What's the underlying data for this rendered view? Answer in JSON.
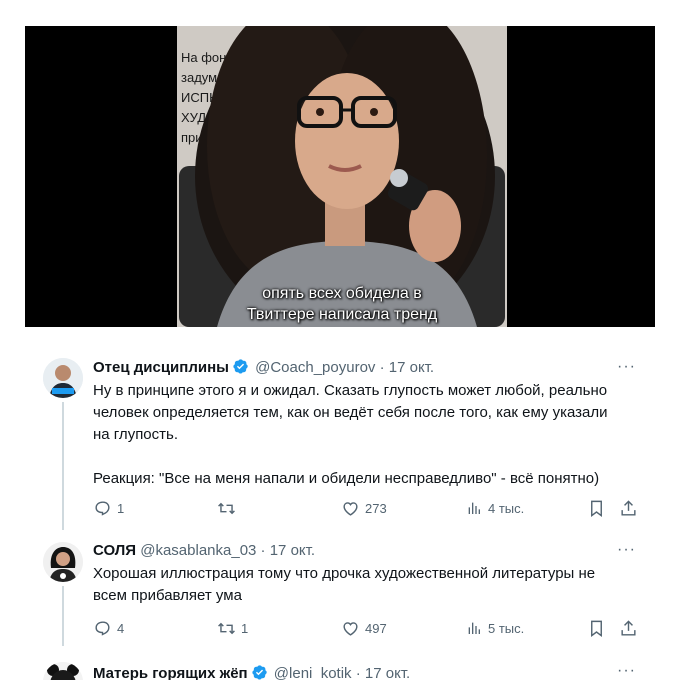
{
  "media": {
    "document_text": "На фоне подр                                       екции\nзадумалась\nИСПЫТЫ\nХУДОЖ                                              оп\nпричи",
    "caption_line1": "опять всех обидела в",
    "caption_line2": "Твиттере написала тренд"
  },
  "tweets": [
    {
      "name": "Отец дисциплины",
      "verified": true,
      "handle": "@Coach_poyurov",
      "separator": "·",
      "date": "17 окт.",
      "more": "···",
      "text": "Ну в принципе этого я и ожидал. Сказать глупость может любой, реально\nчеловек определяется тем, как он ведёт себя после того, как ему указали\nна глупость.\n\nРеакция: \"Все на меня напали и обидели несправедливо\" - всё понятно)",
      "replies": "1",
      "retweets": "",
      "likes": "273",
      "views": "4 тыс."
    },
    {
      "name": "СОЛЯ",
      "verified": false,
      "handle": "@kasablanka_03",
      "separator": "·",
      "date": "17 окт.",
      "more": "···",
      "text": "Хорошая иллюстрация тому что дрочка художественной литературы не\nвсем прибавляет ума",
      "replies": "4",
      "retweets": "1",
      "likes": "497",
      "views": "5 тыс."
    },
    {
      "name": "Матерь горящих жёп",
      "verified": true,
      "handle": "@leni_kotik",
      "separator": "·",
      "date": "17 окт.",
      "more": "···"
    }
  ],
  "icons": {
    "reply": "reply-icon",
    "retweet": "retweet-icon",
    "like": "heart-icon",
    "views": "views-icon",
    "bookmark": "bookmark-icon",
    "share": "share-icon",
    "verified": "verified-badge-icon"
  },
  "colors": {
    "verified_blue": "#1d9bf0",
    "secondary_text": "#536471",
    "primary_text": "#0f1419",
    "thread_line": "#cfd9de"
  }
}
